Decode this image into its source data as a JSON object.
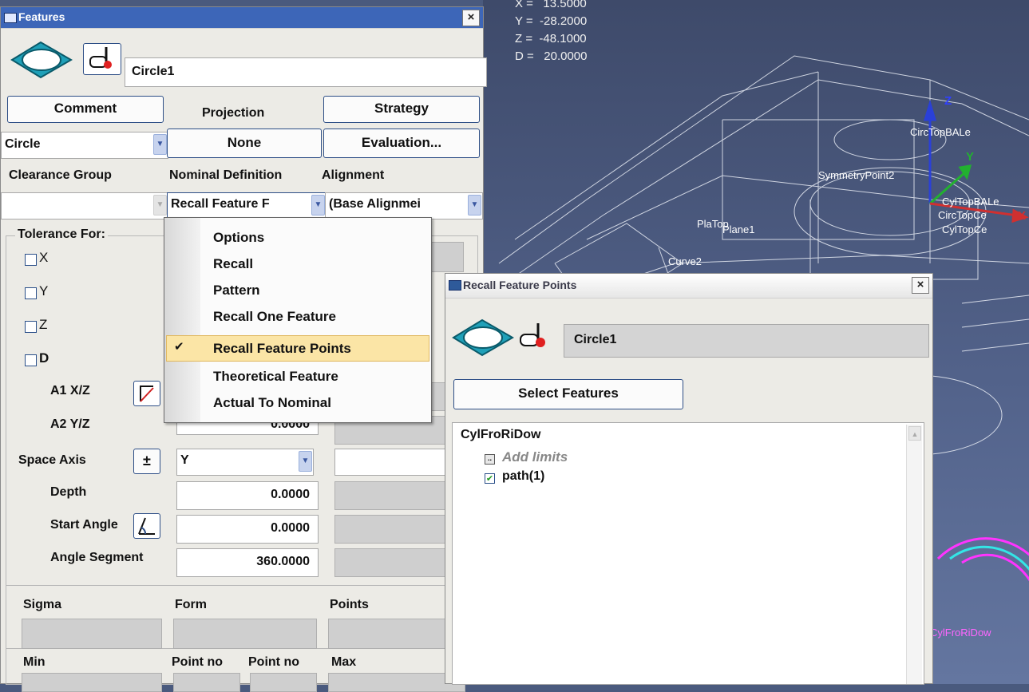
{
  "viewport": {
    "coords": {
      "x": "X =   13.5000",
      "y": "Y =  -28.2000",
      "z": "Z =  -48.1000",
      "d": "D =   20.0000"
    },
    "labels": [
      "SymmetryPoint2",
      "CircTopBALe",
      "CircTopCe",
      "CylTopCe",
      "Plane1",
      "Curve2",
      "PlaTop",
      "CylFroRiDow",
      "CylTopBALe"
    ],
    "axis_z": "Z",
    "axis_y": "Y",
    "axis_x": "X"
  },
  "features": {
    "title": "Features",
    "close": "×",
    "name_value": "Circle1",
    "buttons": {
      "comment": "Comment",
      "strategy": "Strategy",
      "none": "None",
      "evaluation": "Evaluation..."
    },
    "projection_label": "Projection",
    "type_value": "Circle",
    "labels": {
      "clearance": "Clearance Group",
      "nominal": "Nominal Definition",
      "alignment": "Alignment"
    },
    "nominal_value": "Recall Feature F",
    "alignment_value": "(Base Alignmei",
    "tolerance_for": "Tolerance For:",
    "tol_items": [
      "X",
      "Y",
      "Z",
      "D"
    ],
    "a1": "A1 X/Z",
    "a2": "A2 Y/Z",
    "a2_value": "0.0000",
    "space_axis": "Space Axis",
    "plusminus": "±",
    "space_value": "Y",
    "depth": "Depth",
    "depth_value": "0.0000",
    "start_angle": "Start Angle",
    "start_value": "0.0000",
    "angle_segment": "Angle Segment",
    "segment_value": "360.0000",
    "bottom": {
      "sigma": "Sigma",
      "form": "Form",
      "points": "Points",
      "min": "Min",
      "pointno1": "Point no",
      "pointno2": "Point no",
      "max": "Max"
    }
  },
  "menu": {
    "items": [
      "Options",
      "Recall",
      "Pattern",
      "Recall One Feature",
      "Recall Feature Points",
      "Theoretical Feature",
      "Actual To Nominal"
    ],
    "checked_index": 4,
    "check_mark": "✔"
  },
  "recall": {
    "title": "Recall Feature Points",
    "close": "×",
    "name_value": "Circle1",
    "select_button": "Select Features",
    "tree_root": "CylFroRiDow",
    "add_limits": "Add limits",
    "path_item": "path(1)",
    "check_glyph": "✔",
    "limits_glyph": "..",
    "scroll_up": "▲"
  },
  "colors": {
    "accent": "#2d4e86",
    "highlight": "#fbe5a6",
    "grey": "#cfcfcf",
    "viewport": "#52628a"
  }
}
